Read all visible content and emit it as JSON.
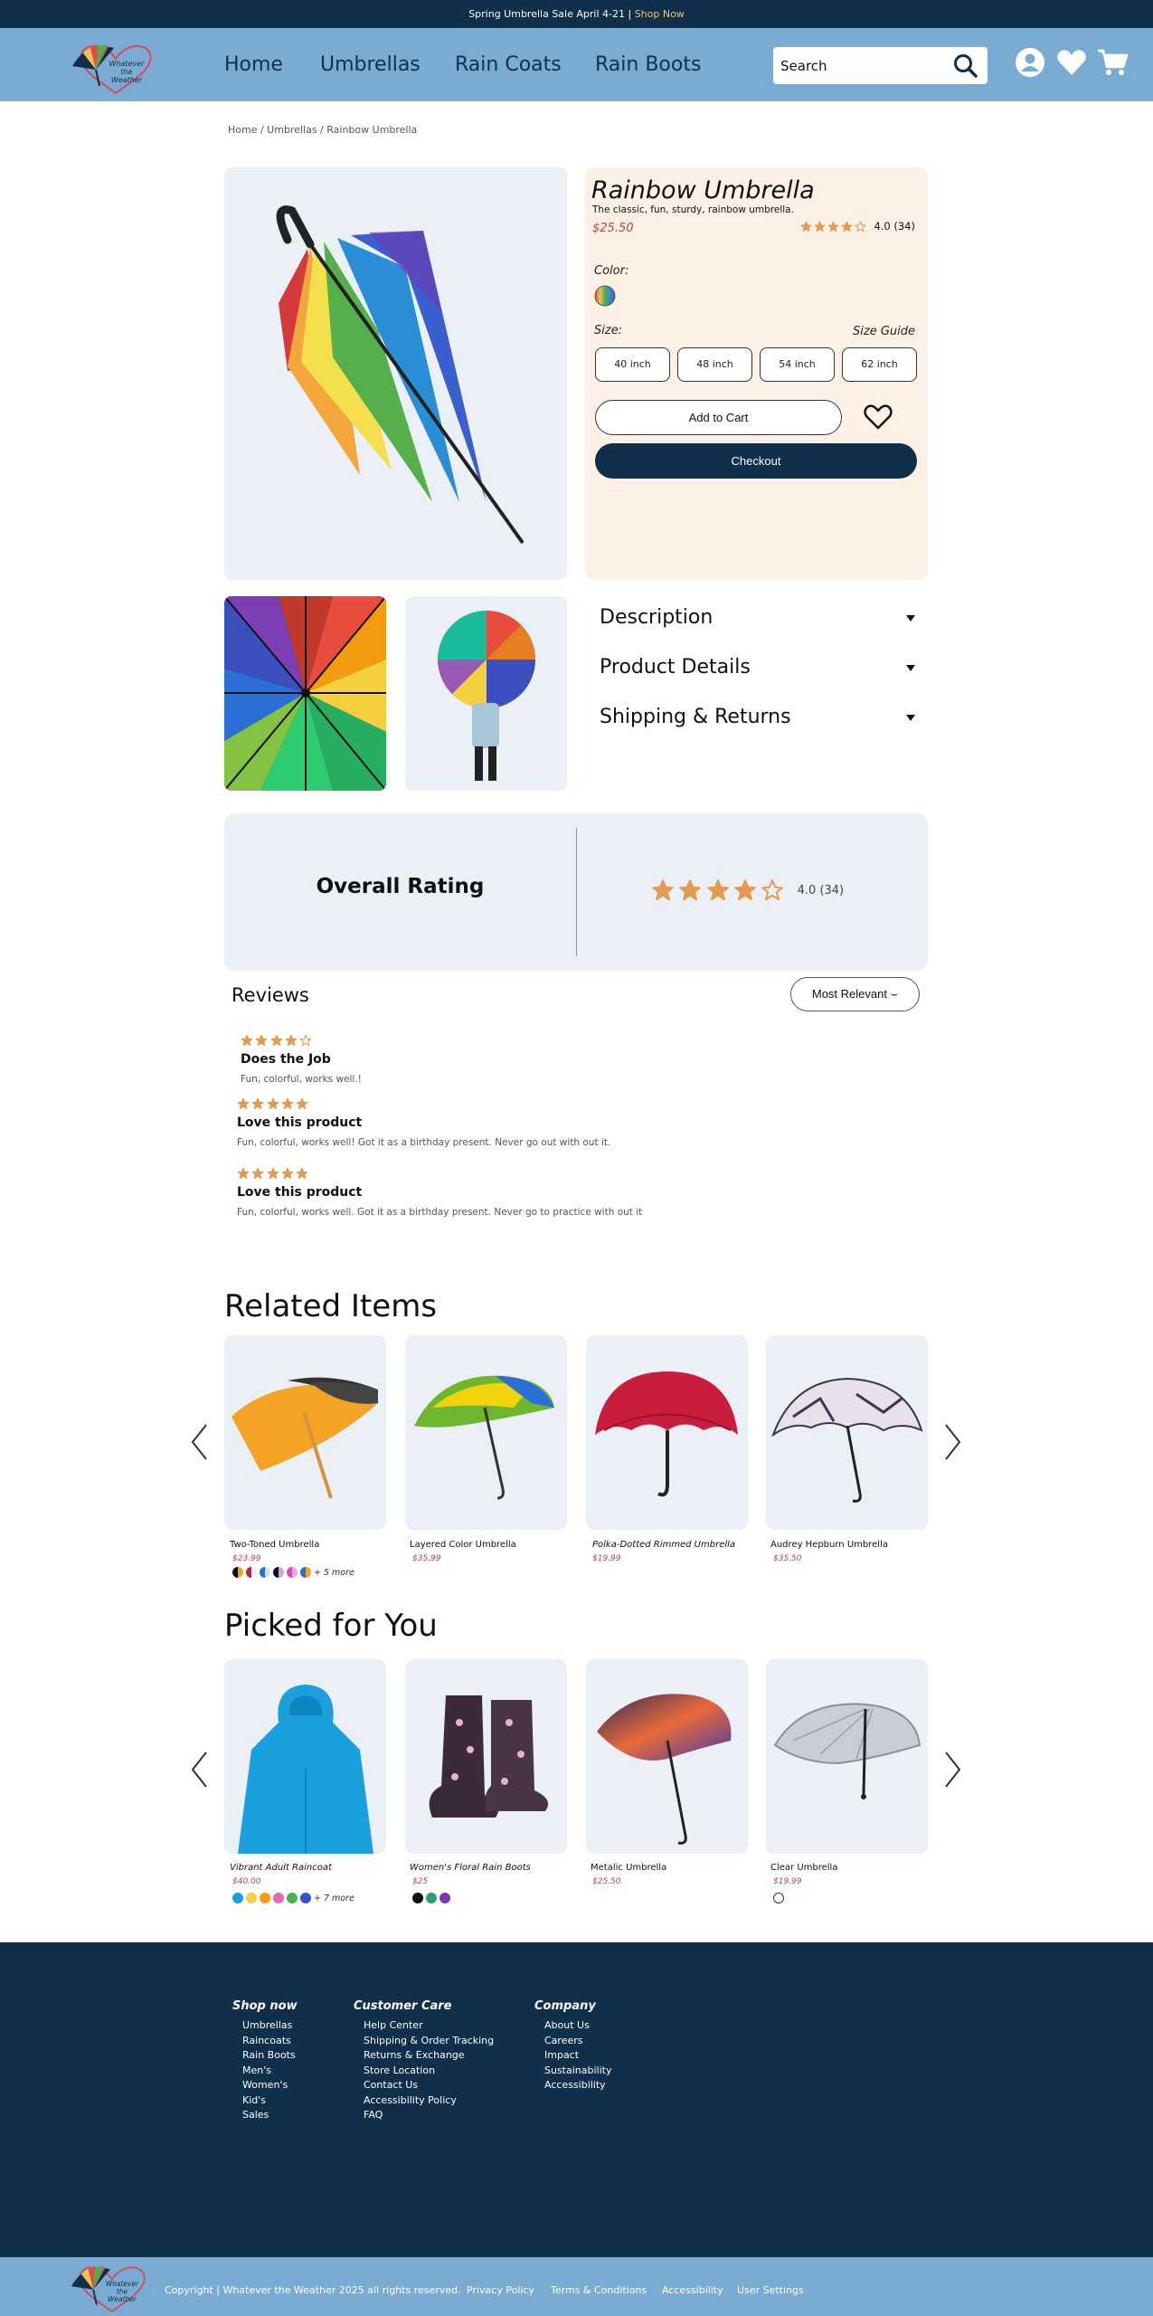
{
  "announcement": {
    "text": "Spring Umbrella Sale April 4-21 | ",
    "link": "Shop Now"
  },
  "logo": {
    "lines": [
      "Whatever",
      "the",
      "Weather"
    ]
  },
  "nav": {
    "items": [
      "Home",
      "Umbrellas",
      "Rain Coats",
      "Rain Boots"
    ]
  },
  "search": {
    "placeholder": "Search",
    "value": ""
  },
  "breadcrumb": "Home / Umbrellas / Rainbow Umbrella",
  "product": {
    "title": "Rainbow Umbrella",
    "subtitle": "The classic, fun, sturdy, rainbow umbrella.",
    "price": "$25.50",
    "rating": 4,
    "rating_text": "4.0 (34)",
    "color_label": "Color:",
    "size_label": "Size:",
    "size_guide": "Size Guide",
    "sizes": [
      "40 inch",
      "48 inch",
      "54 inch",
      "62 inch"
    ],
    "add_to_cart": "Add to Cart",
    "checkout": "Checkout"
  },
  "accordions": [
    "Description",
    "Product Details",
    "Shipping & Returns"
  ],
  "overall_rating": {
    "label": "Overall Rating",
    "rating": 4,
    "text": "4.0 (34)"
  },
  "reviews": {
    "title": "Reviews",
    "sort": "Most Relevant",
    "items": [
      {
        "stars": 4,
        "title": "Does the Job",
        "text": "Fun, colorful, works well.!"
      },
      {
        "stars": 5,
        "title": "Love this product",
        "text": "Fun, colorful, works well! Got it as a birthday present. Never go out with out it."
      },
      {
        "stars": 5,
        "title": "Love this product",
        "text": "Fun, colorful, works well. Got it as a birthday present. Never go to practice with out it"
      }
    ]
  },
  "related": {
    "title": "Related Items",
    "items": [
      {
        "name": "Two-Toned Umbrella",
        "price": "$23.99",
        "more": "+ 5 more"
      },
      {
        "name": "Layered Color Umbrella",
        "price": "$35.99"
      },
      {
        "name": "Polka-Dotted Rimmed Umbrella",
        "price": "$19.99"
      },
      {
        "name": "Audrey Hepburn Umbrella",
        "price": "$35.50"
      }
    ]
  },
  "picked": {
    "title": "Picked for You",
    "items": [
      {
        "name": "Vibrant Adult Raincoat",
        "price": "$40.00",
        "more": "+ 7 more"
      },
      {
        "name": "Women's Floral Rain Boots",
        "price": "$25"
      },
      {
        "name": "Metalic Umbrella",
        "price": "$25.50"
      },
      {
        "name": "Clear Umbrella",
        "price": "$19.99"
      }
    ]
  },
  "footer": {
    "shop": {
      "title": "Shop now",
      "links": [
        "Umbrellas",
        "Raincoats",
        "Rain Boots",
        "Men's",
        "Women's",
        "Kid's",
        "Sales"
      ]
    },
    "care": {
      "title": "Customer Care",
      "links": [
        "Help Center",
        "Shipping & Order Tracking",
        "Returns & Exchange",
        "Store Location",
        "Contact Us",
        "Accessibility Policy",
        "FAQ"
      ]
    },
    "company": {
      "title": "Company",
      "links": [
        "About Us",
        "Careers",
        "Impact",
        "Sustainability",
        "Accessibility"
      ]
    }
  },
  "bottom": {
    "copyright": "Copyright | Whatever the Weather 2025 all rights reserved.",
    "links": [
      "Privacy Policy",
      "Terms & Conditions",
      "Accessibility",
      "User Settings"
    ]
  },
  "colors": {
    "navy": "#0f2f4a",
    "header_blue": "#7aabd3",
    "price_red": "#c0404f",
    "star": "#e39a52",
    "panel": "#fdf1e5",
    "card_bg": "#eaf0f6"
  },
  "icons": [
    "search-icon",
    "account-icon",
    "heart-icon",
    "cart-icon",
    "wishlist-heart-icon",
    "chevron-left-icon",
    "chevron-right-icon",
    "chevron-down-icon"
  ]
}
